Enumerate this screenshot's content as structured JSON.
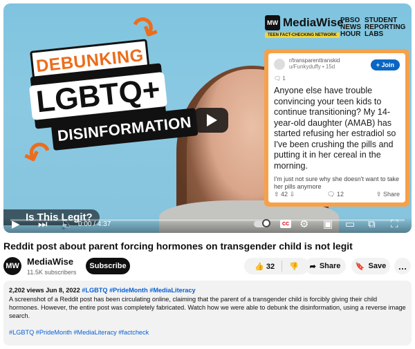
{
  "thumbnail": {
    "headline_1": "DEBUNKING",
    "headline_2": "LGBTQ+",
    "headline_3": "DISINFORMATION",
    "brand_name": "MediaWise",
    "brand_logo": "MW",
    "brand_tagline": "TEEN FACT-CHECKING NETWORK",
    "partner_1": "PBSO NEWS HOUR",
    "partner_2": "STUDENT REPORTING LABS",
    "reddit": {
      "subreddit": "r/transparenttranskid",
      "user_meta": "u/Funkyduffy • 15d",
      "join_label": "+ Join",
      "flair": "1",
      "body": "Anyone else have trouble convincing your teen kids to continue transitioning? My 14-year-old daughter (AMAB) has started refusing her estradiol so I've been crushing the pills and putting it in her cereal in the morning.",
      "extra": "I'm just not sure why she doesn't want to take her pills anymore",
      "upvotes": "42",
      "comments": "12",
      "share_label": "Share"
    }
  },
  "player": {
    "chapter_title": "Is This Legit?",
    "time_display": "0:00 / 4:37",
    "cc_label": "CC"
  },
  "video": {
    "title": "Reddit post about parent forcing hormones on transgender child is not legit"
  },
  "channel": {
    "avatar_initials": "MW",
    "name": "MediaWise",
    "subscribers": "11.5K subscribers",
    "subscribe_label": "Subscribe"
  },
  "actions": {
    "like_count": "32",
    "share_label": "Share",
    "save_label": "Save",
    "more_label": "…"
  },
  "description": {
    "views": "2,202 views",
    "date": "Jun 8, 2022",
    "inline_tags": "#LGBTQ #PrideMonth #MediaLiteracy",
    "text": "A screenshot of a Reddit post has been circulating online, claiming that the parent of a transgender child is forcibly giving their child hormones. However, the entire post was completely fabricated. Watch how we were able to debunk the disinformation, using a reverse image search.",
    "bottom_tags": "#LGBTQ #PrideMonth #MediaLiteracy #factcheck"
  },
  "icons": [
    "play-icon",
    "next-icon",
    "volume-icon",
    "autoplay-toggle-icon",
    "captions-icon",
    "settings-icon",
    "miniplayer-icon",
    "theater-icon",
    "cast-icon",
    "fullscreen-icon",
    "like-icon",
    "dislike-icon",
    "share-icon",
    "save-icon",
    "more-icon"
  ],
  "colors": {
    "accent_orange": "#ec6d1c",
    "reddit_frame": "#f6a14a",
    "link_blue": "#065fd4",
    "captions_red": "#cc0000"
  }
}
